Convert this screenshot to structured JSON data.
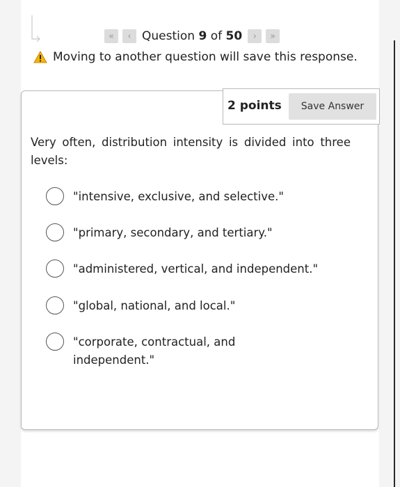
{
  "navigation": {
    "first_icon": "double-chevron-left",
    "prev_icon": "chevron-left",
    "next_icon": "chevron-right",
    "last_icon": "double-chevron-right",
    "question_prefix": "Question",
    "current": "9",
    "of_text": "of",
    "total": "50"
  },
  "warning": {
    "icon": "warning-triangle",
    "text": "Moving to another question will save this response."
  },
  "question": {
    "points": "2 points",
    "save_label": "Save Answer",
    "prompt": "Very often, distribution intensity is divided into three levels:",
    "options": [
      "\"intensive, exclusive, and selective.\"",
      "\"primary, secondary, and tertiary.\"",
      "\"administered, vertical, and independent.\"",
      "\"global, national, and local.\"",
      "\"corporate, contractual, and independent.\""
    ],
    "selected": null
  },
  "colors": {
    "warning_yellow": "#f5b400",
    "button_gray": "#e1e1e1",
    "border_gray": "#b9b9b9"
  }
}
